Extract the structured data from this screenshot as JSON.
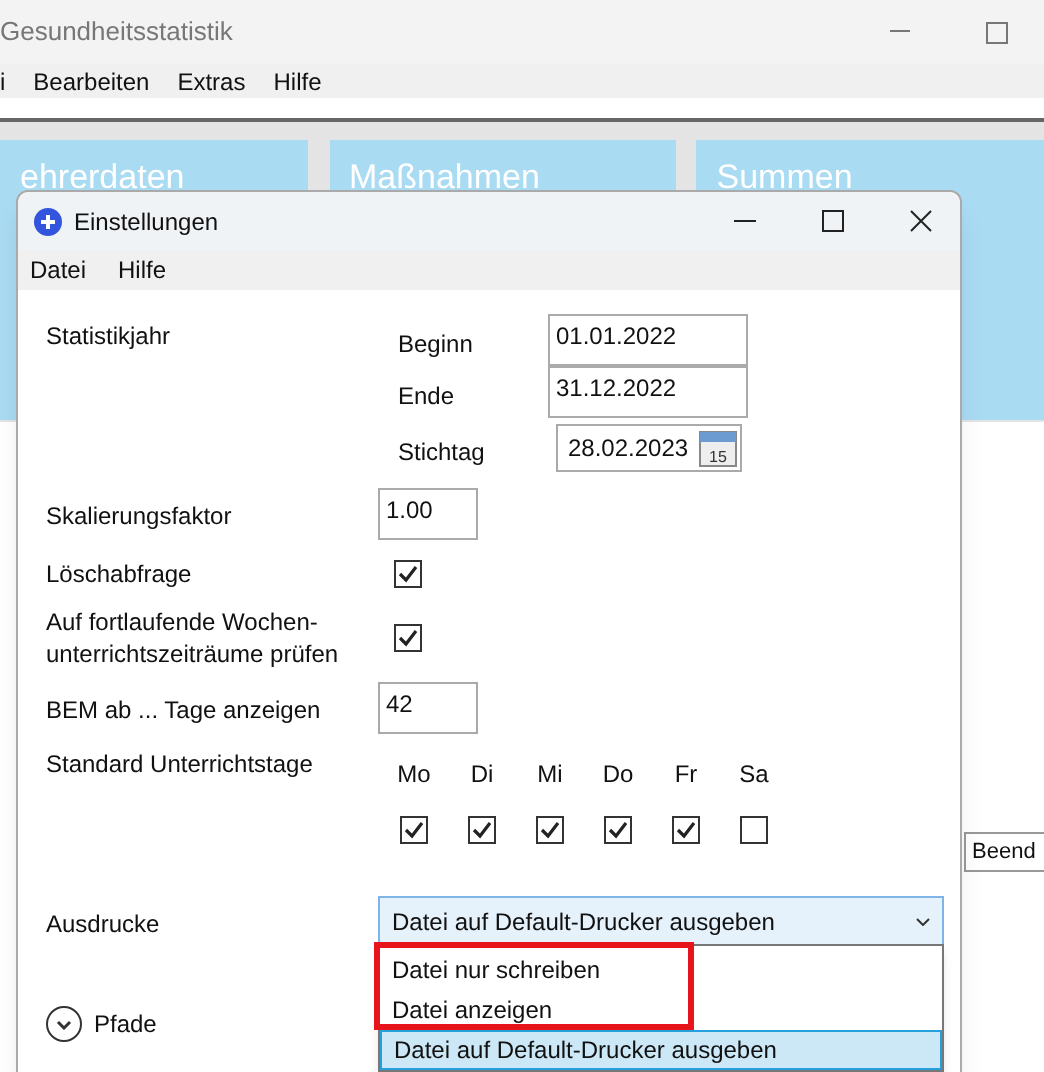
{
  "app": {
    "title": "Gesundheitsstatistik",
    "menu": [
      "i",
      "Bearbeiten",
      "Extras",
      "Hilfe"
    ],
    "tiles": [
      "ehrerdaten",
      "Maßnahmen",
      "Summen"
    ],
    "button": "Beend"
  },
  "dialog": {
    "title": "Einstellungen",
    "menu": [
      "Datei",
      "Hilfe"
    ],
    "statistikjahr": {
      "label": "Statistikjahr",
      "fields": [
        {
          "label": "Beginn",
          "value": "01.01.2022",
          "kind": "text"
        },
        {
          "label": "Ende",
          "value": "31.12.2022",
          "kind": "text"
        },
        {
          "label": "Stichtag",
          "value": "28.02.2023",
          "kind": "date",
          "calendar_day": "15"
        }
      ]
    },
    "skalierung": {
      "label": "Skalierungsfaktor",
      "value": "1.00"
    },
    "loeschabfrage": {
      "label": "Löschabfrage",
      "checked": true
    },
    "wochen": {
      "lines": [
        "Auf fortlaufende Wochen-",
        "unterrichtszeiträume prüfen"
      ],
      "checked": true
    },
    "bem": {
      "label": "BEM ab ... Tage anzeigen",
      "value": "42"
    },
    "tage": {
      "label": "Standard Unterrichtstage",
      "days": [
        {
          "label": "Mo",
          "checked": true
        },
        {
          "label": "Di",
          "checked": true
        },
        {
          "label": "Mi",
          "checked": true
        },
        {
          "label": "Do",
          "checked": true
        },
        {
          "label": "Fr",
          "checked": true
        },
        {
          "label": "Sa",
          "checked": false
        }
      ]
    },
    "ausdrucke": {
      "label": "Ausdrucke",
      "value": "Datei auf Default-Drucker ausgeben",
      "options": [
        {
          "label": "Datei nur schreiben",
          "selected": false
        },
        {
          "label": "Datei anzeigen",
          "selected": false
        },
        {
          "label": "Datei auf Default-Drucker ausgeben",
          "selected": true
        }
      ]
    },
    "pfade": {
      "label": "Pfade",
      "expanded": false
    }
  }
}
